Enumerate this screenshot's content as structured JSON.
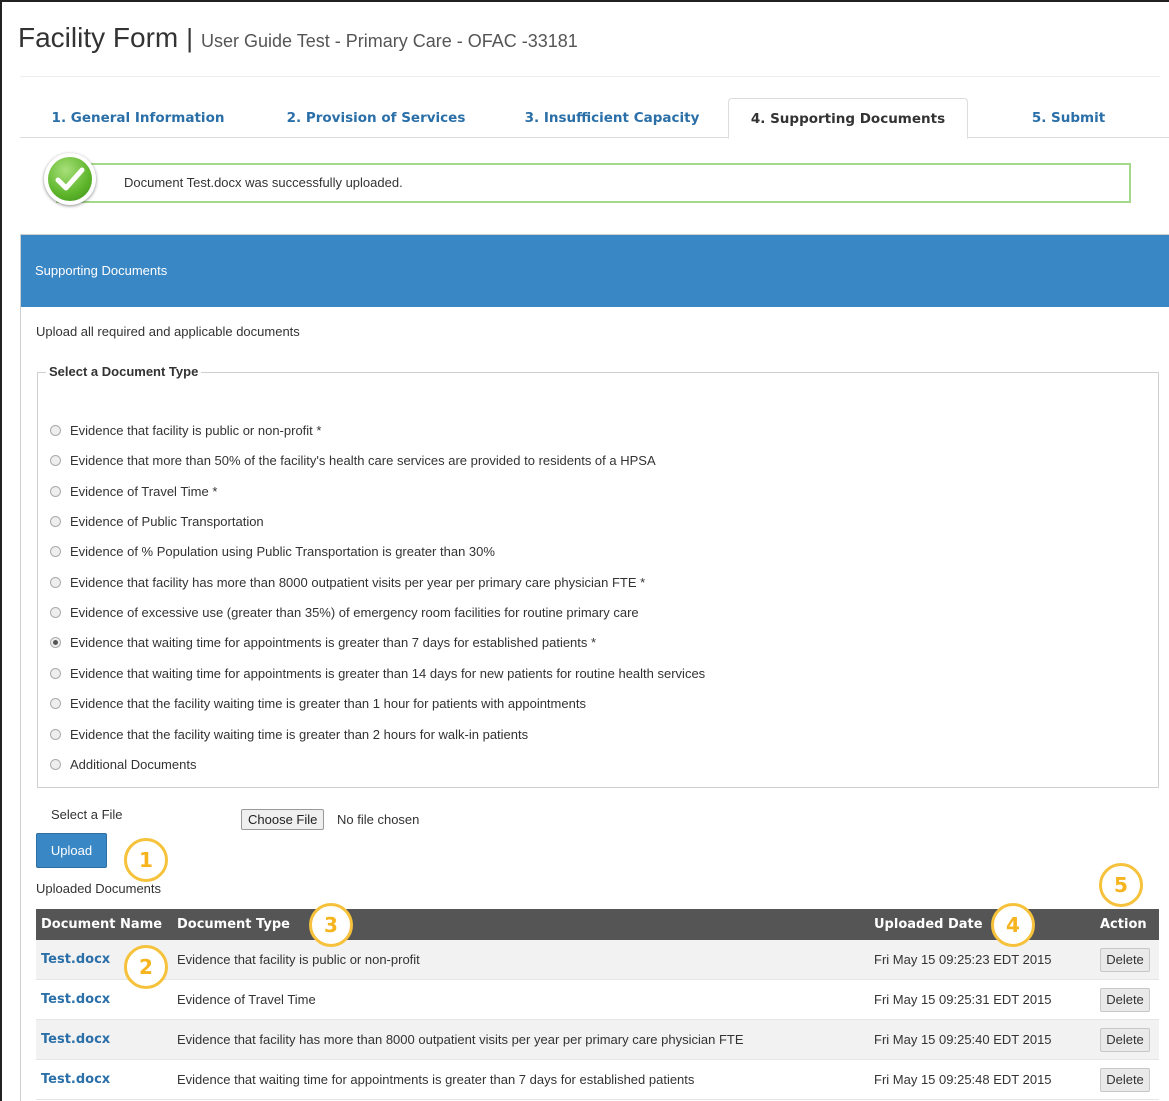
{
  "header": {
    "title": "Facility Form",
    "separator": "|",
    "subtitle": "User Guide Test - Primary Care - OFAC -33181"
  },
  "tabs": [
    {
      "label": "1. General Information"
    },
    {
      "label": "2. Provision of Services"
    },
    {
      "label": "3. Insufficient Capacity"
    },
    {
      "label": "4. Supporting Documents",
      "active": true
    },
    {
      "label": "5. Submit"
    }
  ],
  "alert": {
    "message": "Document Test.docx was successfully uploaded.",
    "icon": "check-circle-icon",
    "border_color": "#a4d98c"
  },
  "panel": {
    "heading": "Supporting Documents",
    "intro": "Upload all required and applicable documents",
    "accent_color": "#3a87c6"
  },
  "document_type": {
    "legend": "Select a Document Type",
    "selected_index": 7,
    "options": [
      "Evidence that facility is public or non-profit *",
      "Evidence that more than 50% of the facility's health care services are provided to residents of a HPSA",
      "Evidence of Travel Time *",
      "Evidence of Public Transportation",
      "Evidence of % Population using Public Transportation is greater than 30%",
      "Evidence that facility has more than 8000 outpatient visits per year per primary care physician FTE *",
      "Evidence of excessive use (greater than 35%) of emergency room facilities for routine primary care",
      "Evidence that waiting time for appointments is greater than 7 days for established patients *",
      "Evidence that waiting time for appointments is greater than 14 days for new patients for routine health services",
      "Evidence that the facility waiting time is greater than 1 hour for patients with appointments",
      "Evidence that the facility waiting time is greater than 2 hours for walk-in patients",
      "Additional Documents"
    ]
  },
  "file": {
    "label": "Select a File",
    "button": "Choose File",
    "status": "No file chosen",
    "upload_button": "Upload"
  },
  "uploaded": {
    "title": "Uploaded Documents",
    "columns": {
      "name": "Document Name",
      "type": "Document Type",
      "date": "Uploaded Date",
      "action": "Action"
    },
    "rows": [
      {
        "name": "Test.docx",
        "type": "Evidence that facility is public or non-profit",
        "date": "Fri May 15 09:25:23 EDT 2015",
        "action": "Delete"
      },
      {
        "name": "Test.docx",
        "type": "Evidence of Travel Time",
        "date": "Fri May 15 09:25:31 EDT 2015",
        "action": "Delete"
      },
      {
        "name": "Test.docx",
        "type": "Evidence that facility has more than 8000 outpatient visits per year per primary care physician FTE",
        "date": "Fri May 15 09:25:40 EDT 2015",
        "action": "Delete"
      },
      {
        "name": "Test.docx",
        "type": "Evidence that waiting time for appointments is greater than 7 days for established patients",
        "date": "Fri May 15 09:25:48 EDT 2015",
        "action": "Delete"
      }
    ]
  },
  "callouts": [
    "1",
    "2",
    "3",
    "4",
    "5"
  ],
  "callout_color": "#f6c23c"
}
